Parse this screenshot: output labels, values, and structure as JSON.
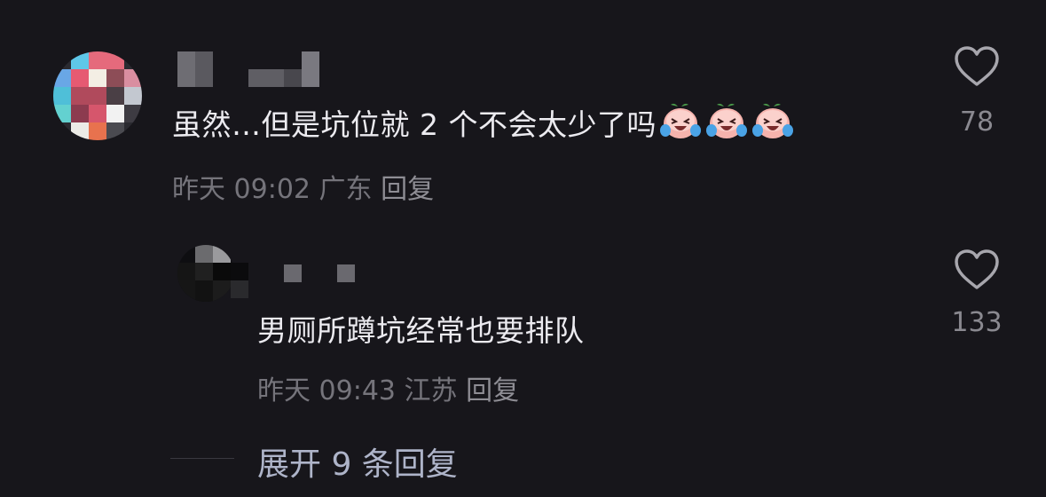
{
  "comments": [
    {
      "text": "虽然…但是坑位就 2 个不会太少了吗",
      "emoji": "crying-laughing-peach-emoji",
      "date": "昨天 09:02",
      "location": "广东",
      "reply_label": "回复",
      "likes": "78"
    },
    {
      "text": "男厕所蹲坑经常也要排队",
      "date": "昨天 09:43",
      "location": "江苏",
      "reply_label": "回复",
      "likes": "133"
    }
  ],
  "expand_replies": "展开 9 条回复",
  "colors": {
    "background": "#17161b",
    "text": "#ecebf0",
    "meta": "#75747b",
    "expand": "#aeb4c9"
  },
  "icons": [
    "heart-outline-icon",
    "crying-laughing-peach-emoji"
  ]
}
